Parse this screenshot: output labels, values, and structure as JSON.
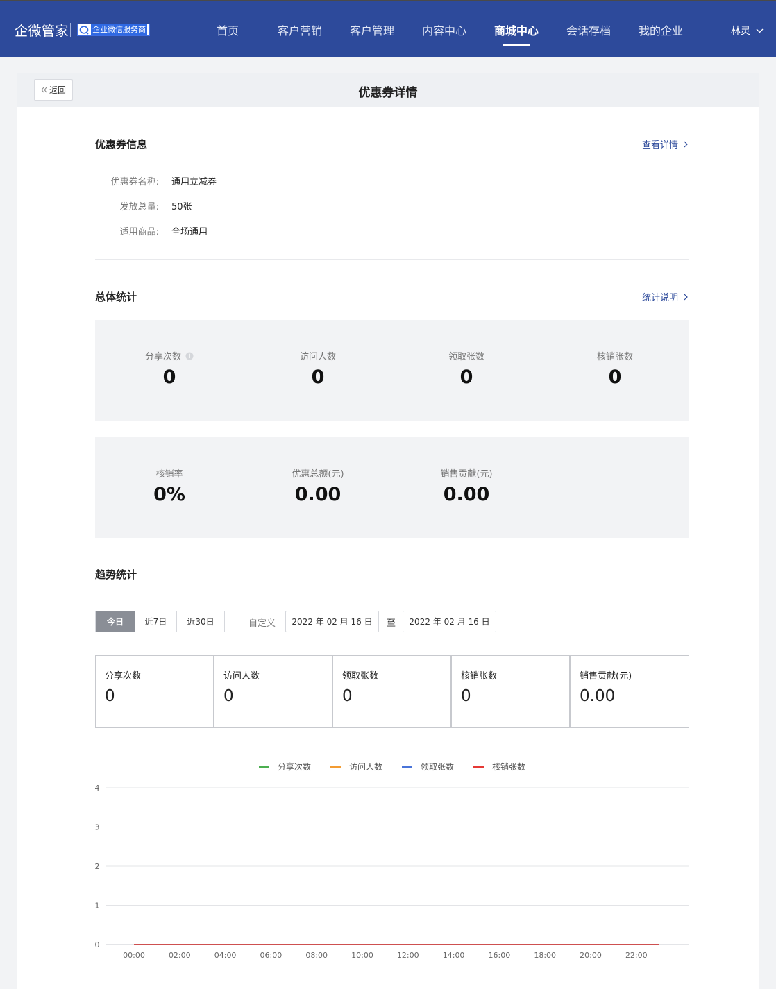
{
  "header": {
    "brand": "企微管家",
    "badge": "企业微信服务商",
    "nav": [
      {
        "label": "首页",
        "active": false
      },
      {
        "label": "客户营销",
        "active": false
      },
      {
        "label": "客户管理",
        "active": false
      },
      {
        "label": "内容中心",
        "active": false
      },
      {
        "label": "商城中心",
        "active": true
      },
      {
        "label": "会话存档",
        "active": false
      },
      {
        "label": "我的企业",
        "active": false
      }
    ],
    "user": "林灵"
  },
  "page": {
    "back": "返回",
    "title": "优惠券详情"
  },
  "coupon_info": {
    "title": "优惠券信息",
    "link": "查看详情",
    "rows": [
      {
        "label": "优惠券名称:",
        "value": "通用立减券"
      },
      {
        "label": "发放总量:",
        "value": "50张"
      },
      {
        "label": "适用商品:",
        "value": "全场通用"
      }
    ]
  },
  "overall": {
    "title": "总体统计",
    "link": "统计说明",
    "row1": [
      {
        "label": "分享次数",
        "value": "0",
        "info": true
      },
      {
        "label": "访问人数",
        "value": "0"
      },
      {
        "label": "领取张数",
        "value": "0"
      },
      {
        "label": "核销张数",
        "value": "0"
      }
    ],
    "row2": [
      {
        "label": "核销率",
        "value": "0%"
      },
      {
        "label": "优惠总额(元)",
        "value": "0.00"
      },
      {
        "label": "销售贡献(元)",
        "value": "0.00"
      }
    ]
  },
  "trend": {
    "title": "趋势统计",
    "ranges": [
      {
        "label": "今日",
        "active": true
      },
      {
        "label": "近7日",
        "active": false
      },
      {
        "label": "近30日",
        "active": false
      }
    ],
    "custom_label": "自定义",
    "start_date": "2022 年 02 月 16 日",
    "to_label": "至",
    "end_date": "2022 年 02 月 16 日",
    "cards": [
      {
        "label": "分享次数",
        "value": "0"
      },
      {
        "label": "访问人数",
        "value": "0"
      },
      {
        "label": "领取张数",
        "value": "0"
      },
      {
        "label": "核销张数",
        "value": "0"
      },
      {
        "label": "销售贡献(元)",
        "value": "0.00"
      }
    ]
  },
  "colors": {
    "nav_bg": "#2d4a9b",
    "link": "#2d4a9b",
    "series_share": "#4caf50",
    "series_visit": "#f39c33",
    "series_claim": "#4a74d9",
    "series_redeem": "#e53935"
  },
  "chart_data": {
    "type": "line",
    "x": [
      "00:00",
      "01:00",
      "02:00",
      "03:00",
      "04:00",
      "05:00",
      "06:00",
      "07:00",
      "08:00",
      "09:00",
      "10:00",
      "11:00",
      "12:00",
      "13:00",
      "14:00",
      "15:00",
      "16:00",
      "17:00",
      "18:00",
      "19:00",
      "20:00",
      "21:00",
      "22:00",
      "23:00"
    ],
    "xticks": [
      "00:00",
      "02:00",
      "04:00",
      "06:00",
      "08:00",
      "10:00",
      "12:00",
      "14:00",
      "16:00",
      "18:00",
      "20:00",
      "22:00"
    ],
    "ylim": [
      0,
      4
    ],
    "yticks": [
      0,
      1,
      2,
      3,
      4
    ],
    "grid": true,
    "legend_position": "top-center",
    "series": [
      {
        "name": "分享次数",
        "color": "#4caf50",
        "values": [
          0,
          0,
          0,
          0,
          0,
          0,
          0,
          0,
          0,
          0,
          0,
          0,
          0,
          0,
          0,
          0,
          0,
          0,
          0,
          0,
          0,
          0,
          0,
          0
        ]
      },
      {
        "name": "访问人数",
        "color": "#f39c33",
        "values": [
          0,
          0,
          0,
          0,
          0,
          0,
          0,
          0,
          0,
          0,
          0,
          0,
          0,
          0,
          0,
          0,
          0,
          0,
          0,
          0,
          0,
          0,
          0,
          0
        ]
      },
      {
        "name": "领取张数",
        "color": "#4a74d9",
        "values": [
          0,
          0,
          0,
          0,
          0,
          0,
          0,
          0,
          0,
          0,
          0,
          0,
          0,
          0,
          0,
          0,
          0,
          0,
          0,
          0,
          0,
          0,
          0,
          0
        ]
      },
      {
        "name": "核销张数",
        "color": "#e53935",
        "values": [
          0,
          0,
          0,
          0,
          0,
          0,
          0,
          0,
          0,
          0,
          0,
          0,
          0,
          0,
          0,
          0,
          0,
          0,
          0,
          0,
          0,
          0,
          0,
          0
        ]
      }
    ]
  }
}
